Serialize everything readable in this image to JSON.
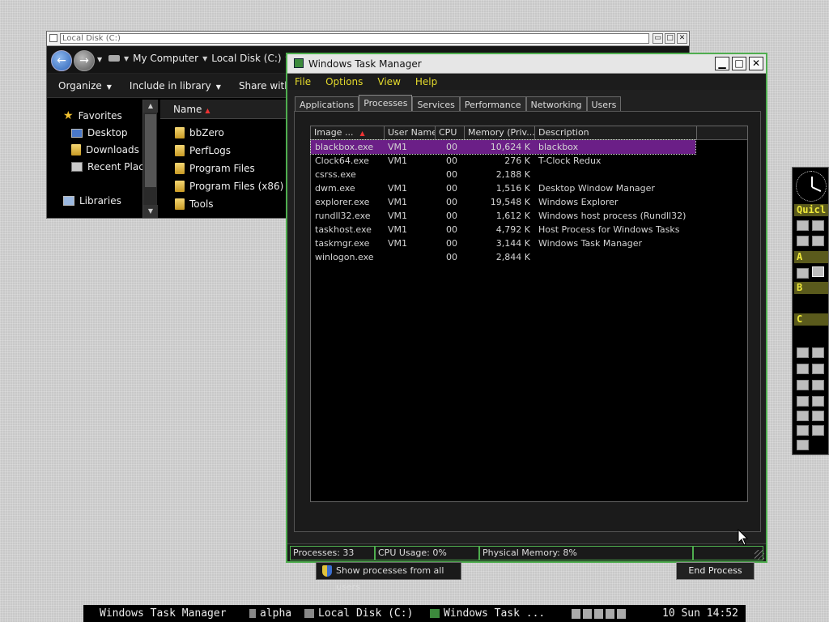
{
  "explorer": {
    "title": "Local Disk (C:)",
    "breadcrumb": [
      "My Computer",
      "Local Disk (C:)"
    ],
    "toolbar": [
      "Organize",
      "Include in library",
      "Share with"
    ],
    "nav": {
      "favorites": "Favorites",
      "items": [
        "Desktop",
        "Downloads",
        "Recent Place"
      ],
      "libraries": "Libraries"
    },
    "column_name": "Name",
    "files": [
      "bbZero",
      "PerfLogs",
      "Program Files",
      "Program Files (x86)",
      "Tools"
    ]
  },
  "taskmgr": {
    "title": "Windows Task Manager",
    "menu": [
      "File",
      "Options",
      "View",
      "Help"
    ],
    "tabs": [
      "Applications",
      "Processes",
      "Services",
      "Performance",
      "Networking",
      "Users"
    ],
    "active_tab": "Processes",
    "columns": [
      "Image ...",
      "User Name",
      "CPU",
      "Memory (Priv...",
      "Description"
    ],
    "processes": [
      {
        "image": "blackbox.exe",
        "user": "VM1",
        "cpu": "00",
        "memory": "10,624 K",
        "description": "blackbox"
      },
      {
        "image": "Clock64.exe",
        "user": "VM1",
        "cpu": "00",
        "memory": "276 K",
        "description": "T-Clock Redux"
      },
      {
        "image": "csrss.exe",
        "user": "",
        "cpu": "00",
        "memory": "2,188 K",
        "description": ""
      },
      {
        "image": "dwm.exe",
        "user": "VM1",
        "cpu": "00",
        "memory": "1,516 K",
        "description": "Desktop Window Manager"
      },
      {
        "image": "explorer.exe",
        "user": "VM1",
        "cpu": "00",
        "memory": "19,548 K",
        "description": "Windows Explorer"
      },
      {
        "image": "rundll32.exe",
        "user": "VM1",
        "cpu": "00",
        "memory": "1,612 K",
        "description": "Windows host process (Rundll32)"
      },
      {
        "image": "taskhost.exe",
        "user": "VM1",
        "cpu": "00",
        "memory": "4,792 K",
        "description": "Host Process for Windows Tasks"
      },
      {
        "image": "taskmgr.exe",
        "user": "VM1",
        "cpu": "00",
        "memory": "3,144 K",
        "description": "Windows Task Manager"
      },
      {
        "image": "winlogon.exe",
        "user": "",
        "cpu": "00",
        "memory": "2,844 K",
        "description": ""
      }
    ],
    "show_all_label": "Show processes from all users",
    "end_process_label": "End Process",
    "status": {
      "processes": "Processes: 33",
      "cpu": "CPU Usage: 0%",
      "memory": "Physical Memory: 8%"
    }
  },
  "dock": {
    "title": "Quicl",
    "sections": [
      "A",
      "B",
      "C"
    ]
  },
  "taskbar": {
    "current": "Windows Task Manager",
    "items": [
      "alpha",
      "Local Disk (C:)",
      "Windows Task ..."
    ],
    "clock": "10 Sun 14:52"
  },
  "colors": {
    "accent_green": "#4fae4f",
    "menu_yellow": "#e3d92c",
    "selection_purple": "#6b1f87"
  }
}
